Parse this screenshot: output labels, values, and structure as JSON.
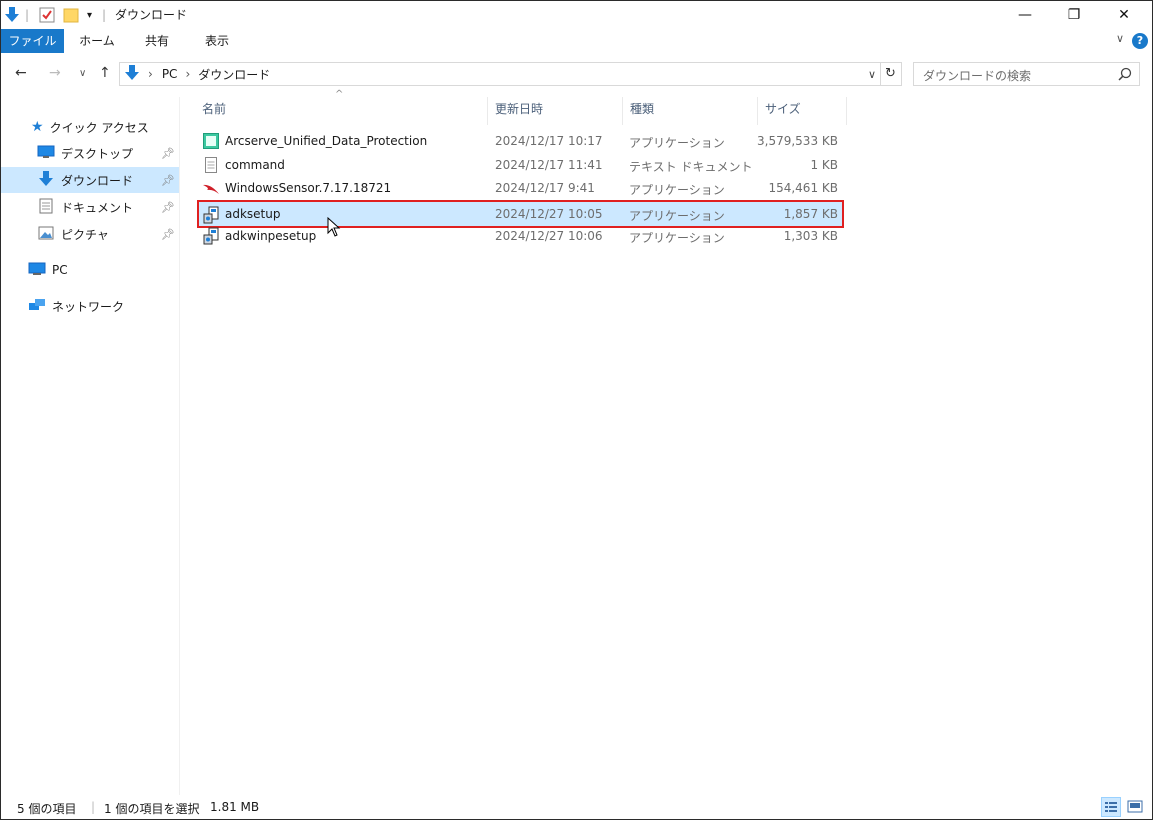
{
  "window": {
    "title": "ダウンロード",
    "controls": {
      "minimize": "—",
      "restore": "❐",
      "close": "✕"
    }
  },
  "ribbon": {
    "tabs": [
      "ファイル",
      "ホーム",
      "共有",
      "表示"
    ],
    "help": "?"
  },
  "address": {
    "path": [
      "PC",
      "ダウンロード"
    ],
    "search_placeholder": "ダウンロードの検索"
  },
  "nav_pane": {
    "quick_access": "クイック アクセス",
    "items": [
      {
        "label": "デスクトップ",
        "pinned": true
      },
      {
        "label": "ダウンロード",
        "pinned": true,
        "selected": true
      },
      {
        "label": "ドキュメント",
        "pinned": true
      },
      {
        "label": "ピクチャ",
        "pinned": true
      }
    ],
    "pc": "PC",
    "network": "ネットワーク"
  },
  "columns": {
    "name": "名前",
    "date": "更新日時",
    "type": "種類",
    "size": "サイズ"
  },
  "files": [
    {
      "name": "Arcserve_Unified_Data_Protection",
      "date": "2024/12/17 10:17",
      "type": "アプリケーション",
      "size": "3,579,533 KB",
      "icon": "arcserve-app-icon"
    },
    {
      "name": "command",
      "date": "2024/12/17 11:41",
      "type": "テキスト ドキュメント",
      "size": "1 KB",
      "icon": "text-document-icon"
    },
    {
      "name": "WindowsSensor.7.17.18721",
      "date": "2024/12/17 9:41",
      "type": "アプリケーション",
      "size": "154,461 KB",
      "icon": "falcon-sensor-icon"
    },
    {
      "name": "adksetup",
      "date": "2024/12/27 10:05",
      "type": "アプリケーション",
      "size": "1,857 KB",
      "icon": "installer-icon",
      "selected": true
    },
    {
      "name": "adkwinpesetup",
      "date": "2024/12/27 10:06",
      "type": "アプリケーション",
      "size": "1,303 KB",
      "icon": "installer-icon"
    }
  ],
  "status": {
    "count": "5 個の項目",
    "selection": "1 個の項目を選択",
    "selection_size": "1.81 MB"
  },
  "colors": {
    "accent": "#1979ca",
    "selection": "#cce8ff",
    "highlight_border": "#e02020"
  }
}
